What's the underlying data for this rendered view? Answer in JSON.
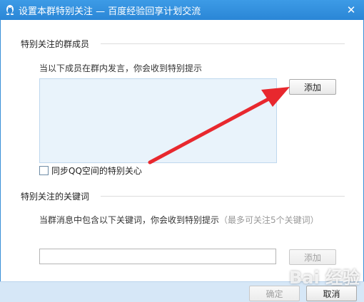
{
  "window": {
    "title": "设置本群特别关注 — 百度经验回享计划交流",
    "close_symbol": "✕"
  },
  "members_section": {
    "title": "特别关注的群成员",
    "description": "当以下成员在群内发言，你会收到特别提示",
    "add_button": "添加",
    "sync_checkbox_label": "同步QQ空间的特别关心",
    "sync_checked": false
  },
  "keywords_section": {
    "title": "特别关注的关键词",
    "description": "当群消息中包含以下关键词，你会收到特别提示",
    "hint": "（最多可关注5个关键词）",
    "input_value": "",
    "add_button": "添加"
  },
  "footer": {
    "ok_button": "确定",
    "cancel_button": "取消"
  },
  "watermark": "Bai 经验",
  "colors": {
    "titlebar": "#2a86d6",
    "member_box": "#e9f3fb",
    "footer": "#d6e7f7",
    "annotation_arrow": "#e8282e"
  }
}
